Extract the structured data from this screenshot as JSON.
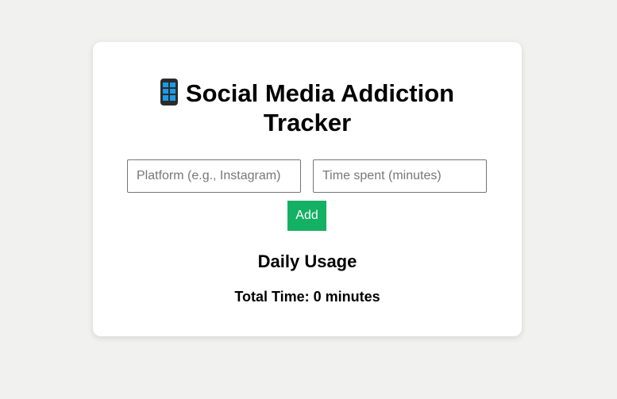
{
  "header": {
    "title_line1": "Social Media Addiction",
    "title_line2": "Tracker",
    "icon": "mobile-phone-icon"
  },
  "form": {
    "platform_placeholder": "Platform (e.g., Instagram)",
    "platform_value": "",
    "time_placeholder": "Time spent (minutes)",
    "time_value": "",
    "add_label": "Add"
  },
  "usage": {
    "heading": "Daily Usage",
    "total_label": "Total Time: 0 minutes"
  },
  "colors": {
    "background": "#f1f1ef",
    "card": "#ffffff",
    "add_button": "#14b064"
  }
}
